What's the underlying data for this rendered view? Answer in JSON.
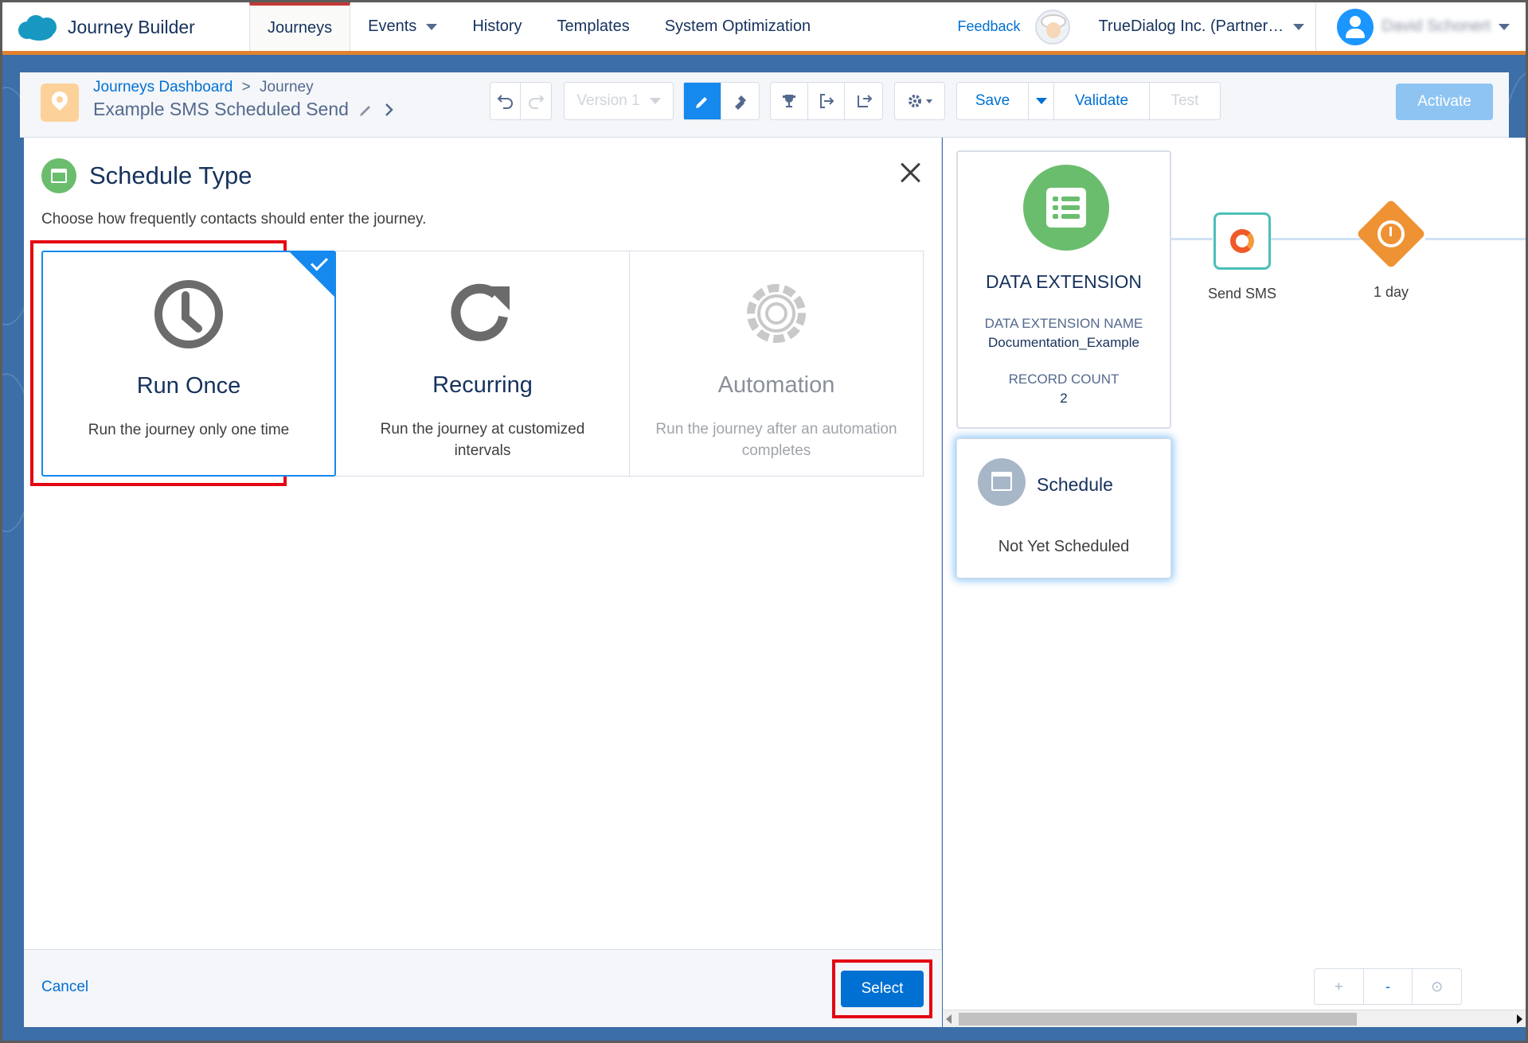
{
  "nav": {
    "brand": "Journey Builder",
    "tabs": [
      {
        "label": "Journeys",
        "active": true,
        "dropdown": false
      },
      {
        "label": "Events",
        "active": false,
        "dropdown": true
      },
      {
        "label": "History",
        "active": false,
        "dropdown": false
      },
      {
        "label": "Templates",
        "active": false,
        "dropdown": false
      },
      {
        "label": "System Optimization",
        "active": false,
        "dropdown": false
      }
    ],
    "feedback": "Feedback",
    "org": "TrueDialog Inc. (Partner…",
    "user": "David Schonert"
  },
  "toolbar": {
    "breadcrumb_link": "Journeys Dashboard",
    "breadcrumb_sep": ">",
    "breadcrumb_current": "Journey",
    "journey_title": "Example SMS Scheduled Send",
    "version": "Version 1",
    "save": "Save",
    "validate": "Validate",
    "test": "Test",
    "activate": "Activate"
  },
  "panel": {
    "title": "Schedule Type",
    "description": "Choose how frequently contacts should enter the journey.",
    "options": [
      {
        "label": "Run Once",
        "sub": "Run the journey only one time",
        "selected": true,
        "disabled": false,
        "icon": "clock-icon"
      },
      {
        "label": "Recurring",
        "sub": "Run the journey at customized intervals",
        "selected": false,
        "disabled": false,
        "icon": "refresh-icon"
      },
      {
        "label": "Automation",
        "sub": "Run the journey after an automation completes",
        "selected": false,
        "disabled": true,
        "icon": "gear-icon"
      }
    ],
    "cancel": "Cancel",
    "select": "Select"
  },
  "canvas": {
    "entry": {
      "title": "DATA EXTENSION",
      "name_label": "DATA EXTENSION NAME",
      "name_value": "Documentation_Example",
      "count_label": "RECORD COUNT",
      "count_value": "2"
    },
    "schedule": {
      "title": "Schedule",
      "status": "Not Yet Scheduled"
    },
    "activities": [
      {
        "label": "Send SMS"
      },
      {
        "label": "1 day"
      }
    ],
    "zoom": {
      "in": "+",
      "out": "-",
      "fit": "⊙"
    }
  },
  "colors": {
    "accent_orange": "#e2832f",
    "brand_blue": "#0070d2",
    "selected_blue": "#1589ee",
    "highlight_red": "#e30613",
    "green": "#6bbd6e"
  }
}
